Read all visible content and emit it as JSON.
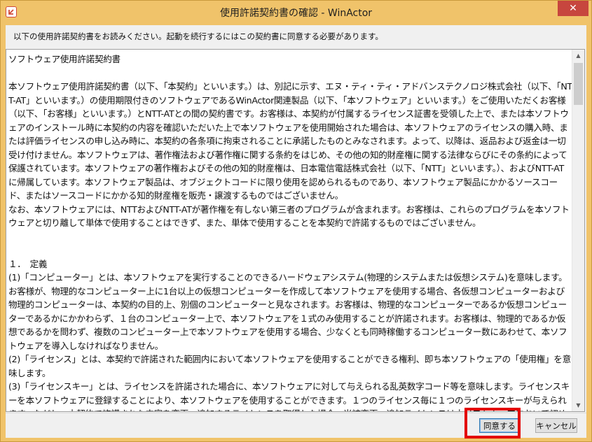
{
  "window": {
    "title": "使用許諾契約書の確認 - WinActor",
    "close_glyph": "✕"
  },
  "notice": "以下の使用許諾契約書をお読みください。起動を続行するにはこの契約書に同意する必要があります。",
  "license_text": "ソフトウェア使用許諾契約書\n\n本ソフトウェア使用許諾契約書（以下、「本契約」といいます。）は、別記に示す、エヌ・ティ・ティ・アドバンステクノロジ株式会社（以下、「NTT-AT」といいます。）の使用期限付きのソフトウェアであるWinActor関連製品（以下、「本ソフトウェア」といいます。）をご使用いただくお客様（以下、「お客様」といいます。）とNTT-ATとの間の契約書です。お客様は、本契約が付属するライセンス証書を受領した上で、または本ソフトウェアのインストール時に本契約の内容を確認いただいた上で本ソフトウェアを使用開始された場合は、本ソフトウェアのライセンスの購入時、または評価ライセンスの申し込み時に、本契約の各条項に拘束されることに承諾したものとみなされます。よって、以降は、返品および返金は一切受け付けません。本ソフトウェアは、著作権法および著作権に関する条約をはじめ、その他の知的財産権に関する法律ならびにその条約によって保護されています。本ソフトウェアの著作権およびその他の知的財産権は、日本電信電話株式会社（以下、「NTT」といいます。）、およびNTT-ATに帰属しています。本ソフトウェア製品は、オブジェクトコードに限り使用を認められるものであり、本ソフトウェア製品にかかるソースコード、またはソースコードにかかる知的財産権を販売・譲渡するものではございません。\nなお、本ソフトウェアには、NTTおよびNTT-ATが著作権を有しない第三者のプログラムが含まれます。お客様は、これらのプログラムを本ソフトウェアと切り離して単体で使用することはできず、また、単体で使用することを本契約で許諾するものではございません。\n\n\n１．　定義\n(1)「コンピューター」とは、本ソフトウェアを実行することのできるハードウェアシステム(物理的システムまたは仮想システム)を意味します。お客様が、物理的なコンピューター上に1台以上の仮想コンピューターを作成して本ソフトウェアを使用する場合、各仮想コンピューターおよび物理的コンピューターは、本契約の目的上、別個のコンピューターと見なされます。お客様は、物理的なコンピューターであるか仮想コンピューターであるかにかかわらず、１台のコンピューター上で、本ソフトウェアを１式のみ使用することが許諾されます。お客様は、物理的であるか仮想であるかを問わず、複数のコンピューター上で本ソフトウェアを使用する場合、少なくとも同時稼働するコンピューター数にあわせて、本ソフトウェアを導入しなければなりません。\n(2)「ライセンス」とは、本契約で許諾された範囲内において本ソフトウェアを使用することができる権利、即ち本ソフトウェアの「使用権」を意味します。\n(3)「ライセンスキー」とは、ライセンスを許諾された場合に、本ソフトウェアに対して与えられる乱英数字コード等を意味します。ライセンスキーを本ソフトウェアに登録することにより、本ソフトウェアを使用することができます。１つのライセンス毎に１つのライセンスキーが与えられます。ただし、本契約で許諾された内容を変更・追加するライセンスを取得した場合、当該変更・追加ライセンスは本ソフトウェアにおいて初めに与えられたライセンスと一体のものとみなします。なお、コンピューターが同一か否かに関わらず、１つのライセ",
  "buttons": {
    "agree": "同意する",
    "cancel": "キャンセル"
  },
  "scrollbar": {
    "up_glyph": "▲",
    "down_glyph": "▼",
    "scroll_position": 0.0
  },
  "colors": {
    "frame": "#f0c36a",
    "close": "#c7463e",
    "highlight": "#e30000"
  }
}
